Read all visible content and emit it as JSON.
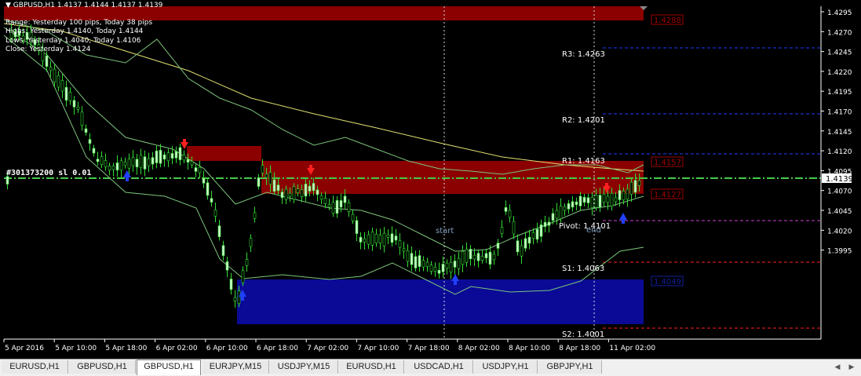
{
  "window": {
    "header": "GBPUSD,H1  1.4137 1.4144 1.4137 1.4139",
    "info_lines": [
      "Range: Yesterday 100 pips, Today 38 pips",
      "Highs: Yesterday 1.4140, Today 1.4144",
      "Lows: Yesterday 1.4040, Today 1.4106",
      "Close: Yesterday 1.4124"
    ],
    "left_tag": "#301373200 sl 0.01"
  },
  "price_axis": {
    "labels": [
      "1.4295",
      "1.4270",
      "1.4245",
      "1.4220",
      "1.4195",
      "1.4170",
      "1.4145",
      "1.4120",
      "1.4095",
      "1.4070",
      "1.4045",
      "1.4020",
      "1.3995"
    ],
    "current_price": "1.4139"
  },
  "time_axis": {
    "labels": [
      "5 Apr 2016",
      "5 Apr 10:00",
      "5 Apr 18:00",
      "6 Apr 02:00",
      "6 Apr 10:00",
      "6 Apr 18:00",
      "7 Apr 02:00",
      "7 Apr 10:00",
      "7 Apr 18:00",
      "8 Apr 02:00",
      "8 Apr 10:00",
      "8 Apr 18:00",
      "11 Apr 02:00"
    ]
  },
  "pivots": {
    "r3": "R3: 1.4263",
    "r2": "R2: 1.4201",
    "r1": "R1: 1.4163",
    "pivot": "Pivot: 1.4101",
    "s1": "S1: 1.4063",
    "s2": "S2: 1.4001"
  },
  "zones": {
    "top": "1.4288",
    "upper": "1.4157",
    "lower": "1.4127",
    "demand": "1.4049"
  },
  "chart_labels": {
    "start": "start",
    "end": "end"
  },
  "colors": {
    "supply_zone": "#8b0000",
    "demand_zone": "#0a0a96",
    "bull_candle": "#ccffcc",
    "bear_candle": "#00b000",
    "bands": "#7cc47c",
    "slow_ma": "#e0e070",
    "sell_arrow": "#ff2020",
    "buy_arrow": "#2040ff"
  },
  "tabs": [
    {
      "label": "EURUSD,H1",
      "active": false
    },
    {
      "label": "GBPUSD,H1",
      "active": false
    },
    {
      "label": "GBPUSD,H1",
      "active": true
    },
    {
      "label": "EURJPY,M15",
      "active": false
    },
    {
      "label": "USDJPY,M15",
      "active": false
    },
    {
      "label": "EURUSD,H1",
      "active": false
    },
    {
      "label": "USDCAD,H1",
      "active": false
    },
    {
      "label": "USDJPY,H1",
      "active": false
    },
    {
      "label": "GBPJPY,H1",
      "active": false
    }
  ]
}
